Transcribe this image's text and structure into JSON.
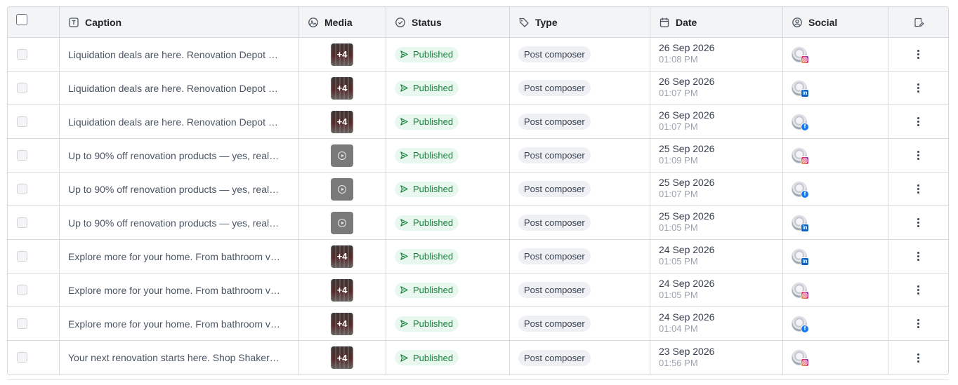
{
  "columns": {
    "caption": "Caption",
    "media": "Media",
    "status": "Status",
    "type": "Type",
    "date": "Date",
    "social": "Social"
  },
  "rows": [
    {
      "caption": "Liquidation deals are here. Renovation Depot …",
      "media": {
        "kind": "image",
        "count": "+4"
      },
      "status": "Published",
      "type": "Post composer",
      "date": "26 Sep 2026",
      "time": "01:08 PM",
      "network": "instagram"
    },
    {
      "caption": "Liquidation deals are here. Renovation Depot …",
      "media": {
        "kind": "image",
        "count": "+4"
      },
      "status": "Published",
      "type": "Post composer",
      "date": "26 Sep 2026",
      "time": "01:07 PM",
      "network": "linkedin"
    },
    {
      "caption": "Liquidation deals are here. Renovation Depot …",
      "media": {
        "kind": "image",
        "count": "+4"
      },
      "status": "Published",
      "type": "Post composer",
      "date": "26 Sep 2026",
      "time": "01:07 PM",
      "network": "facebook"
    },
    {
      "caption": "Up to 90% off renovation products — yes, real…",
      "media": {
        "kind": "video",
        "count": ""
      },
      "status": "Published",
      "type": "Post composer",
      "date": "25 Sep 2026",
      "time": "01:09 PM",
      "network": "instagram"
    },
    {
      "caption": "Up to 90% off renovation products — yes, real…",
      "media": {
        "kind": "video",
        "count": ""
      },
      "status": "Published",
      "type": "Post composer",
      "date": "25 Sep 2026",
      "time": "01:07 PM",
      "network": "facebook"
    },
    {
      "caption": "Up to 90% off renovation products — yes, real…",
      "media": {
        "kind": "video",
        "count": ""
      },
      "status": "Published",
      "type": "Post composer",
      "date": "25 Sep 2026",
      "time": "01:05 PM",
      "network": "linkedin"
    },
    {
      "caption": "Explore more for your home. From bathroom v…",
      "media": {
        "kind": "image",
        "count": "+4"
      },
      "status": "Published",
      "type": "Post composer",
      "date": "24 Sep 2026",
      "time": "01:05 PM",
      "network": "linkedin"
    },
    {
      "caption": "Explore more for your home. From bathroom v…",
      "media": {
        "kind": "image",
        "count": "+4"
      },
      "status": "Published",
      "type": "Post composer",
      "date": "24 Sep 2026",
      "time": "01:05 PM",
      "network": "instagram"
    },
    {
      "caption": "Explore more for your home. From bathroom v…",
      "media": {
        "kind": "image",
        "count": "+4"
      },
      "status": "Published",
      "type": "Post composer",
      "date": "24 Sep 2026",
      "time": "01:04 PM",
      "network": "facebook"
    },
    {
      "caption": "Your next renovation starts here. Shop Shaker…",
      "media": {
        "kind": "image",
        "count": "+4"
      },
      "status": "Published",
      "type": "Post composer",
      "date": "23 Sep 2026",
      "time": "01:56 PM",
      "network": "instagram"
    }
  ],
  "colors": {
    "status_bg": "#e8f8ee",
    "status_fg": "#16803c",
    "instagram": "#e1306c",
    "linkedin": "#0a66c2",
    "facebook": "#1877f2"
  },
  "icons": {
    "caption": "text-box-icon",
    "media": "image-icon",
    "status": "check-circle-icon",
    "type": "tag-icon",
    "date": "calendar-icon",
    "social": "user-circle-icon",
    "column_settings": "edit-columns-icon",
    "row_menu": "kebab-menu-icon",
    "status_badge": "send-icon"
  }
}
